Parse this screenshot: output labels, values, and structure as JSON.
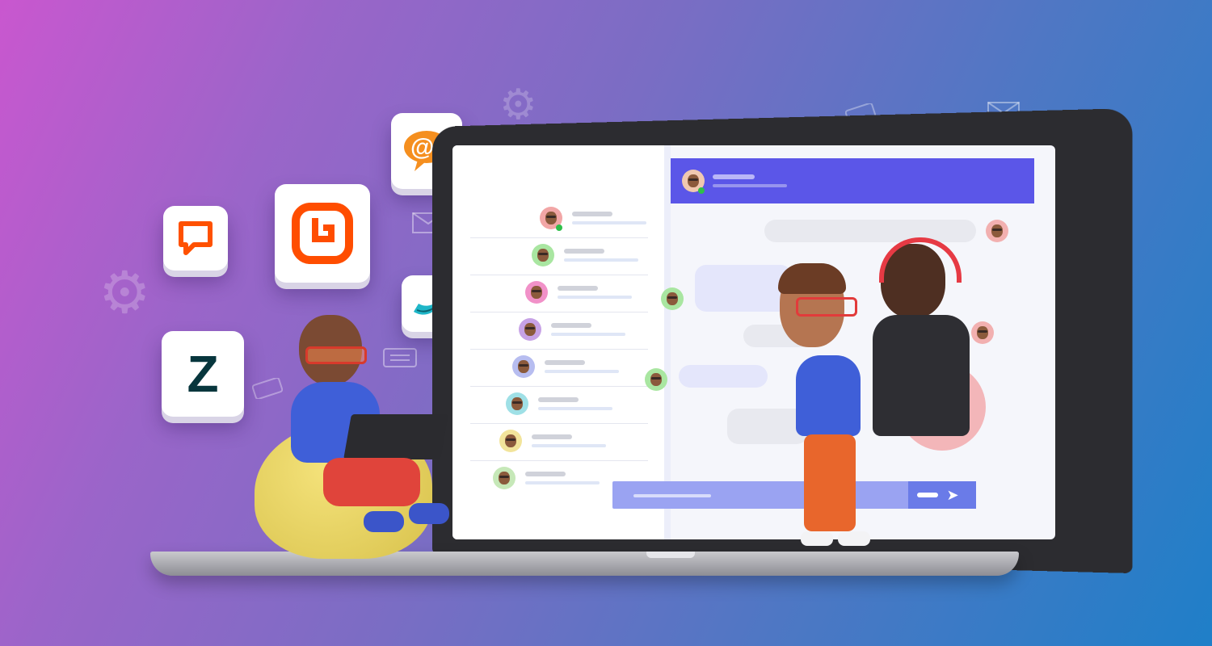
{
  "colors": {
    "bg_start": "#c957cf",
    "bg_end": "#1f7fc8",
    "chat_header": "#5b56e8",
    "composer": "#9aa3f2",
    "send_button": "#6a7be8"
  },
  "icons": {
    "app_tiles": [
      "livechat-app-icon",
      "brand-b-app-icon",
      "at-chat-app-icon",
      "zendesk-app-icon",
      "swirl-app-icon"
    ],
    "decorations": [
      "gear-icon",
      "envelope-icon",
      "ticket-icon",
      "chat-bubble-icon"
    ],
    "send": "send-arrow-icon"
  },
  "tiles": {
    "at_glyph": "@",
    "zendesk_glyph": "Z"
  },
  "send_glyph": "➤",
  "contacts_count_visual": 8
}
